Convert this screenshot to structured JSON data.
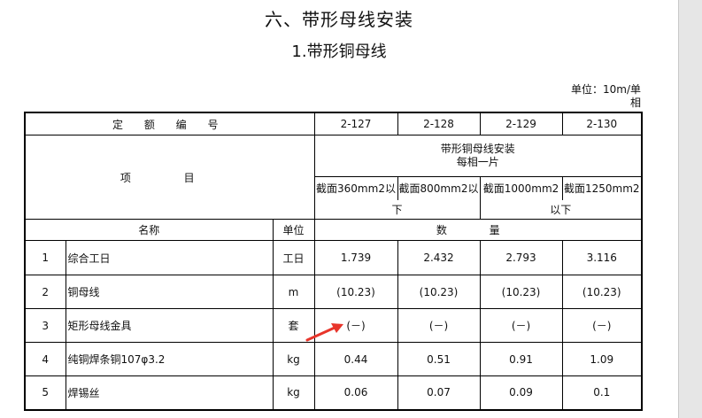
{
  "heading": "六、带形母线安装",
  "subheading": "1.带形铜母线",
  "unit_text_1": "单位：10m/单",
  "unit_text_2": "相",
  "table": {
    "quota_label": "定 额 编 号",
    "codes": [
      "2-127",
      "2-128",
      "2-129",
      "2-130"
    ],
    "item_label": "项 目",
    "group_title_1": "带形铜母线安装",
    "group_title_2": "每相一片",
    "specs": [
      "截面360mm2以",
      "截面800mm2以",
      "截面1000mm2",
      "截面1250mm2"
    ],
    "spec_tail_1": "下",
    "spec_tail_2": "以下",
    "col_name": "名称",
    "col_unit": "单位",
    "col_qty": "数 量",
    "rows": [
      {
        "no": "1",
        "name": "综合工日",
        "unit": "工日",
        "v": [
          "1.739",
          "2.432",
          "2.793",
          "3.116"
        ]
      },
      {
        "no": "2",
        "name": "铜母线",
        "unit": "m",
        "v": [
          "(10.23)",
          "(10.23)",
          "(10.23)",
          "(10.23)"
        ]
      },
      {
        "no": "3",
        "name": "矩形母线金具",
        "unit": "套",
        "v": [
          "(－)",
          "(－)",
          "(－)",
          "(－)"
        ]
      },
      {
        "no": "4",
        "name": "纯铜焊条铜107φ3.2",
        "unit": "kg",
        "v": [
          "0.44",
          "0.51",
          "0.91",
          "1.09"
        ]
      },
      {
        "no": "5",
        "name": "焊锡丝",
        "unit": "kg",
        "v": [
          "0.06",
          "0.07",
          "0.09",
          "0.1"
        ]
      }
    ]
  },
  "colors": {
    "arrow": "#e8352b",
    "gutter": "#e6e6e6"
  }
}
